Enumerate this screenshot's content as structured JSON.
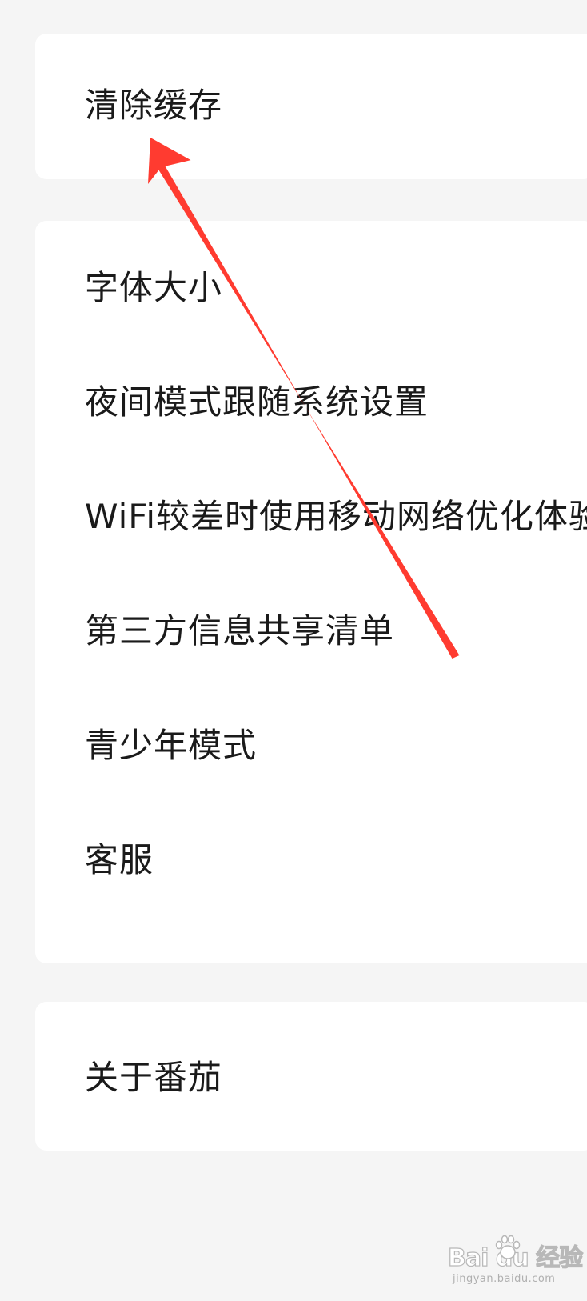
{
  "settings": {
    "group1": {
      "items": [
        {
          "label": "清除缓存"
        }
      ]
    },
    "group2": {
      "items": [
        {
          "label": "字体大小"
        },
        {
          "label": "夜间模式跟随系统设置"
        },
        {
          "label": "WiFi较差时使用移动网络优化体验"
        },
        {
          "label": "第三方信息共享清单"
        },
        {
          "label": "青少年模式"
        },
        {
          "label": "客服"
        }
      ]
    },
    "group3": {
      "items": [
        {
          "label": "关于番茄"
        }
      ]
    }
  },
  "annotation": {
    "arrow_color": "#ff3b30",
    "points_to": "清除缓存"
  },
  "watermark": {
    "logo_text": "Bai du 经验",
    "url": "jingyan.baidu.com"
  }
}
